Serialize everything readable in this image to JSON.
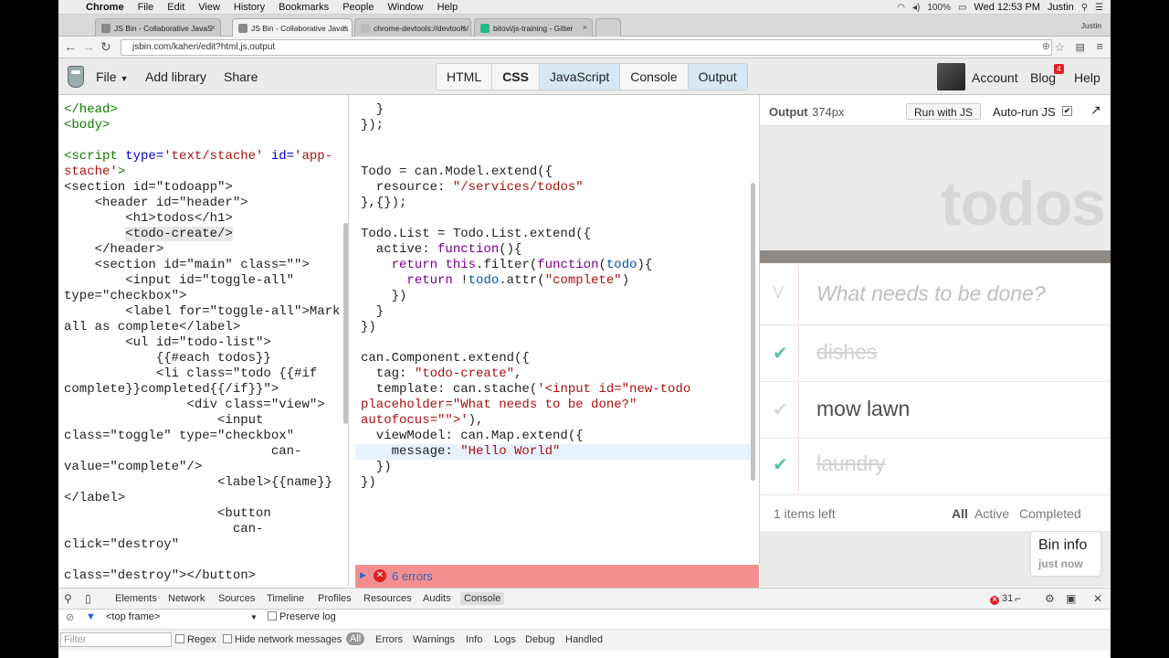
{
  "menubar": {
    "app": "Chrome",
    "items": [
      "File",
      "Edit",
      "View",
      "History",
      "Bookmarks",
      "People",
      "Window",
      "Help"
    ],
    "battery": "100%",
    "clock": "Wed 12:53 PM",
    "user": "Justin"
  },
  "tabs": [
    {
      "label": "JS Bin - Collaborative JavaS",
      "active": false
    },
    {
      "label": "JS Bin - Collaborative Javas",
      "active": true
    },
    {
      "label": "chrome-devtools://devtools/",
      "active": false
    },
    {
      "label": "bitovi/js-training - Gitter",
      "active": false
    }
  ],
  "tabbar_user": "Justin",
  "address": {
    "url": "jsbin.com/kaheri/edit?html,js,output"
  },
  "jsbin": {
    "file": "File",
    "add_library": "Add library",
    "share": "Share",
    "panels": [
      "HTML",
      "CSS",
      "JavaScript",
      "Console",
      "Output"
    ],
    "account": "Account",
    "blog": "Blog",
    "blog_badge": "4",
    "help": "Help"
  },
  "output": {
    "label": "Output",
    "size": "374px",
    "run": "Run with JS",
    "autorun": "Auto-run JS",
    "check": "✔",
    "title": "todos",
    "placeholder": "What needs to be done?",
    "items": [
      {
        "mark": "✔",
        "text": "dishes",
        "done": true
      },
      {
        "mark": "✔",
        "text": "mow lawn",
        "done": false
      },
      {
        "mark": "✔",
        "text": "laundry",
        "done": true
      }
    ],
    "toggle_all": "V",
    "left": "1 items left",
    "filters": [
      "All",
      "Active",
      "Completed"
    ],
    "bininfo_title": "Bin info",
    "bininfo_sub": "just now"
  },
  "errors": {
    "text": "6 errors"
  },
  "devtools": {
    "tabs": [
      "Elements",
      "Network",
      "Sources",
      "Timeline",
      "Profiles",
      "Resources",
      "Audits",
      "Console"
    ],
    "error_count": "31",
    "frame": "<top frame>",
    "preserve": "Preserve log",
    "filter_placeholder": "Filter",
    "regex": "Regex",
    "hide_network": "Hide network messages",
    "levels": [
      "All",
      "Errors",
      "Warnings",
      "Info",
      "Logs",
      "Debug",
      "Handled"
    ]
  },
  "colors": {
    "accent": "#5dc2af",
    "error": "#f38f8f",
    "panel_active": "#d8e8f3"
  }
}
